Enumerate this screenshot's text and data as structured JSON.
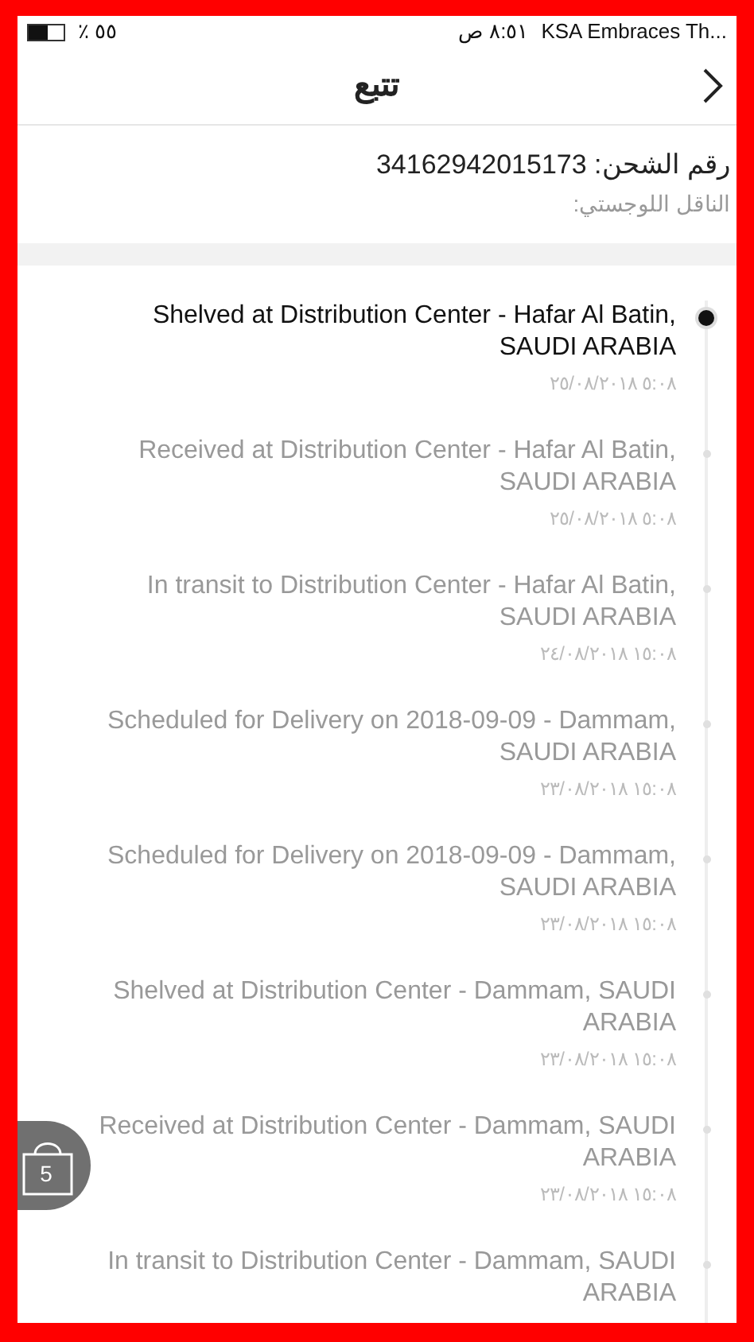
{
  "status_bar": {
    "battery": "٪ ٥٥",
    "time": "٨:٥١ ص",
    "carrier": "KSA Embraces Th..."
  },
  "header": {
    "title": "تتبع"
  },
  "shipment": {
    "number_label": "رقم الشحن: 34162942015173",
    "carrier_label": "الناقل اللوجستي:"
  },
  "events": [
    {
      "text": "Shelved at Distribution Center - Hafar Al Batin, SAUDI ARABIA",
      "time": "٥:٠٨ ٢٥/٠٨/٢٠١٨",
      "active": true
    },
    {
      "text": "Received at Distribution Center - Hafar Al Batin, SAUDI ARABIA",
      "time": "٥:٠٨ ٢٥/٠٨/٢٠١٨",
      "active": false
    },
    {
      "text": "In transit to Distribution Center - Hafar Al Batin, SAUDI ARABIA",
      "time": "١٥:٠٨ ٢٤/٠٨/٢٠١٨",
      "active": false
    },
    {
      "text": "Scheduled for Delivery on 2018-09-09 - Dammam, SAUDI ARABIA",
      "time": "١٥:٠٨ ٢٣/٠٨/٢٠١٨",
      "active": false
    },
    {
      "text": "Scheduled for Delivery on 2018-09-09 - Dammam, SAUDI ARABIA",
      "time": "١٥:٠٨ ٢٣/٠٨/٢٠١٨",
      "active": false
    },
    {
      "text": "Shelved at Distribution Center - Dammam, SAUDI ARABIA",
      "time": "١٥:٠٨ ٢٣/٠٨/٢٠١٨",
      "active": false
    },
    {
      "text": "Received at Distribution Center - Dammam, SAUDI ARABIA",
      "time": "١٥:٠٨ ٢٣/٠٨/٢٠١٨",
      "active": false
    },
    {
      "text": "In transit to Distribution Center - Dammam, SAUDI ARABIA",
      "active": false
    }
  ],
  "cart": {
    "count": "5"
  }
}
